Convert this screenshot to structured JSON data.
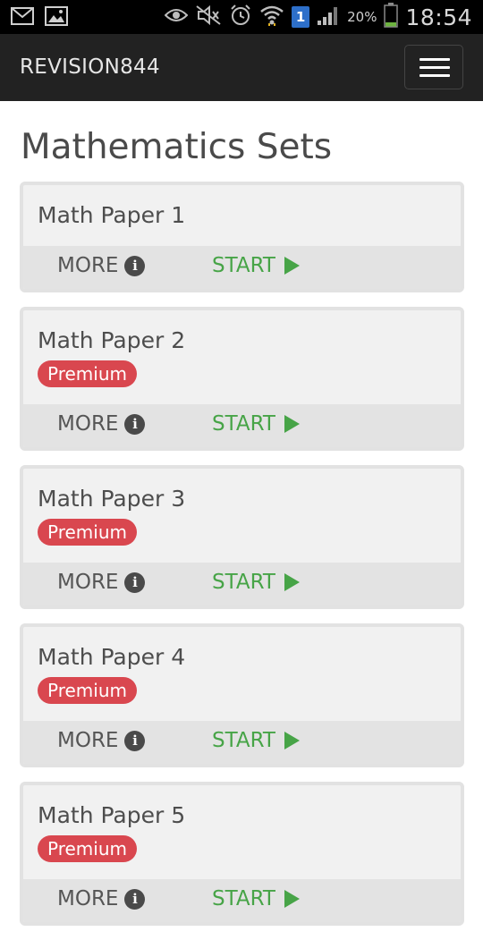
{
  "status_bar": {
    "time": "18:54",
    "battery_percent": "20%",
    "sim_number": "1",
    "icons": [
      "mail-icon",
      "image-icon",
      "eye-icon",
      "mute-icon",
      "alarm-icon",
      "wifi-icon",
      "signal-icon",
      "battery-icon"
    ]
  },
  "navbar": {
    "brand": "REVISION844",
    "menu_icon": "hamburger-icon"
  },
  "page": {
    "title": "Mathematics Sets"
  },
  "papers": [
    {
      "title": "Math Paper 1",
      "badge": "",
      "more_label": "MORE",
      "start_label": "START"
    },
    {
      "title": "Math Paper 2",
      "badge": "Premium",
      "more_label": "MORE",
      "start_label": "START"
    },
    {
      "title": "Math Paper 3",
      "badge": "Premium",
      "more_label": "MORE",
      "start_label": "START"
    },
    {
      "title": "Math Paper 4",
      "badge": "Premium",
      "more_label": "MORE",
      "start_label": "START"
    },
    {
      "title": "Math Paper 5",
      "badge": "Premium",
      "more_label": "MORE",
      "start_label": "START"
    }
  ],
  "colors": {
    "navbar_bg": "#222222",
    "premium_badge": "#d9474f",
    "start_green": "#47a447",
    "card_bg": "#f1f1f1",
    "card_footer_bg": "#e3e3e3"
  }
}
